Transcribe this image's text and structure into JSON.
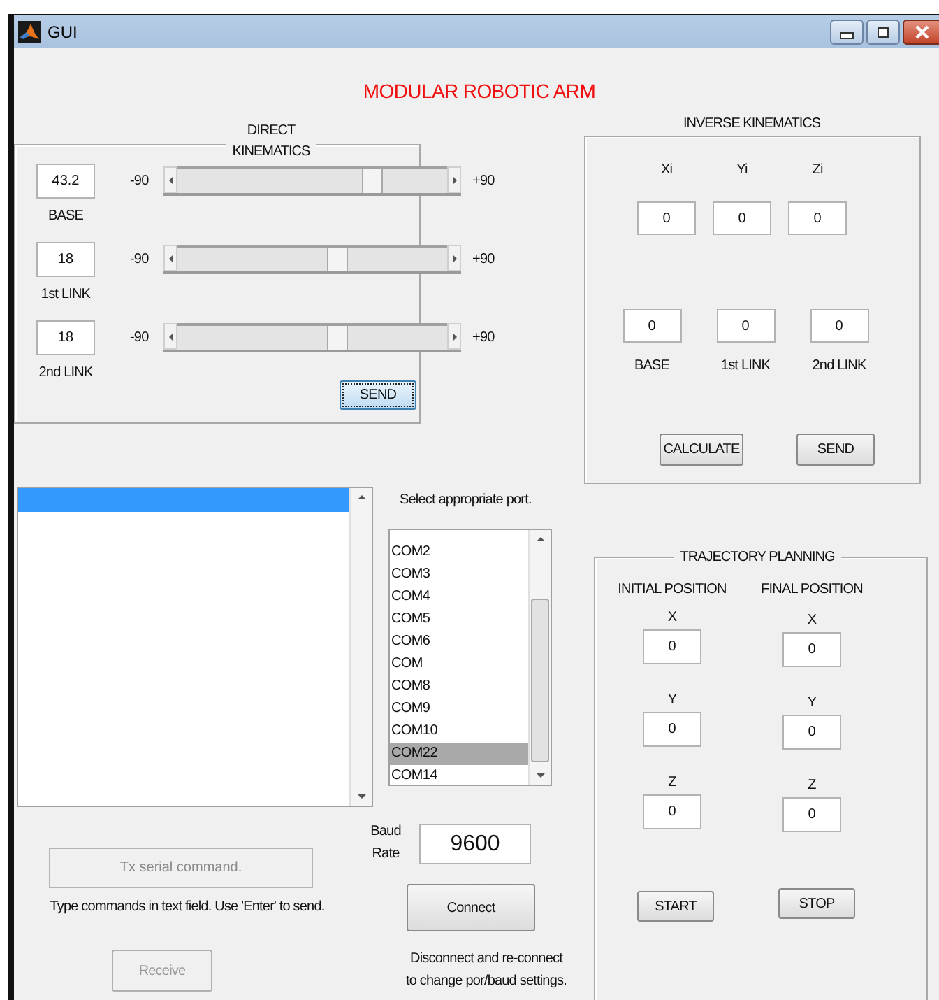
{
  "window": {
    "title": "GUI"
  },
  "heading": "MODULAR ROBOTIC ARM",
  "direct_kinematics": {
    "title": "DIRECT\nKINEMATICS",
    "joints": [
      {
        "value": "43.2",
        "label": "BASE",
        "min_label": "-90",
        "max_label": "+90",
        "level": 0.74
      },
      {
        "value": "18",
        "label": "1st LINK",
        "min_label": "-90",
        "max_label": "+90",
        "level": 0.6
      },
      {
        "value": "18",
        "label": "2nd LINK",
        "min_label": "-90",
        "max_label": "+90",
        "level": 0.6
      }
    ],
    "send_button": {
      "label": "SEND",
      "focused": true
    }
  },
  "inverse_kinematics": {
    "title": "INVERSE KINEMATICS",
    "coordinates": [
      {
        "label": "Xi",
        "value": "0"
      },
      {
        "label": "Yi",
        "value": "0"
      },
      {
        "label": "Zi",
        "value": "0"
      }
    ],
    "joints": [
      {
        "label": "BASE",
        "value": "0"
      },
      {
        "label": "1st LINK",
        "value": "0"
      },
      {
        "label": "2nd LINK",
        "value": "0"
      }
    ],
    "buttons": [
      "CALCULATE",
      "SEND"
    ]
  },
  "log_list": {
    "selected_row": true
  },
  "port_select": {
    "label": "Select appropriate port.",
    "ports": [
      {
        "name": "COM2",
        "selected": false
      },
      {
        "name": "COM3",
        "selected": false
      },
      {
        "name": "COM4",
        "selected": false
      },
      {
        "name": "COM5",
        "selected": false
      },
      {
        "name": "COM6",
        "selected": false
      },
      {
        "name": "COM",
        "selected": false
      },
      {
        "name": "COM8",
        "selected": false
      },
      {
        "name": "COM9",
        "selected": false
      },
      {
        "name": "COM10",
        "selected": false
      },
      {
        "name": "COM22",
        "selected": true
      },
      {
        "name": "COM14",
        "selected": false
      }
    ]
  },
  "baud": {
    "label": "Baud\nRate",
    "value": "9600"
  },
  "tx_field": {
    "value": "Tx serial command.",
    "disabled": true
  },
  "tx_hint": "Type commands in text field. Use 'Enter' to send.",
  "receive_button": {
    "label": "Receive",
    "disabled": true
  },
  "connect_button": {
    "label": "Connect"
  },
  "connect_hint": "Disconnect and re-connect\nto change por/baud settings.",
  "trajectory_planning": {
    "title": "TRAJECTORY PLANNING",
    "columns": [
      {
        "heading": "INITIAL POSITION",
        "axes": [
          {
            "label": "X",
            "value": "0"
          },
          {
            "label": "Y",
            "value": "0"
          },
          {
            "label": "Z",
            "value": "0"
          }
        ]
      },
      {
        "heading": "FINAL POSITION",
        "axes": [
          {
            "label": "X",
            "value": "0"
          },
          {
            "label": "Y",
            "value": "0"
          },
          {
            "label": "Z",
            "value": "0"
          }
        ]
      }
    ],
    "buttons": [
      "START",
      "STOP"
    ]
  }
}
